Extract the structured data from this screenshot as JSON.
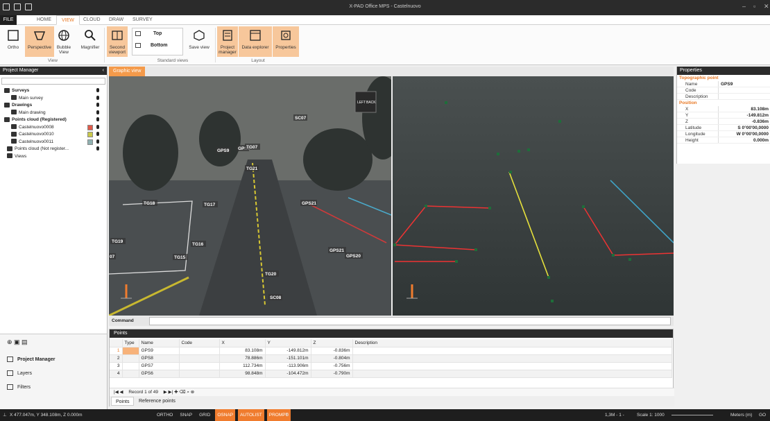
{
  "window": {
    "title": "X-PAD Office MPS - Castelnuovo"
  },
  "ribbon_tabs": [
    "FILE",
    "HOME",
    "VIEW",
    "CLOUD",
    "DRAW",
    "SURVEY"
  ],
  "ribbon": {
    "view_group": {
      "label": "View",
      "buttons": [
        "Ortho",
        "Perspective",
        "Bubble View",
        "Magnifier"
      ]
    },
    "second_viewport": "Second viewport",
    "standard_views": {
      "label": "Standard views",
      "items": [
        "Top",
        "Bottom"
      ],
      "save": "Save view"
    },
    "layout": {
      "label": "Layout",
      "buttons": [
        "Project manager",
        "Data explorer",
        "Properties"
      ]
    }
  },
  "project_manager": {
    "title": "Project Manager",
    "tree": [
      {
        "label": "Surveys",
        "bold": true
      },
      {
        "label": "Main survey"
      },
      {
        "label": "Drawings",
        "bold": true
      },
      {
        "label": "Main drawing"
      },
      {
        "label": "Points cloud (Registered)",
        "bold": true
      },
      {
        "label": "Castelnuovo0008",
        "color": "#e05a4a"
      },
      {
        "label": "Castelnuovo0010",
        "color": "#c9c84a"
      },
      {
        "label": "Castelnuovo0011",
        "color": "#8fb0b0"
      },
      {
        "label": "Points cloud (Not register..."
      },
      {
        "label": "Views"
      }
    ],
    "nav": [
      "Project Manager",
      "Layers",
      "Filters"
    ]
  },
  "graphic_view": {
    "tab": "Graphic view",
    "labels": [
      "GPS9",
      "GPS8",
      "TG07",
      "TG21",
      "SC07",
      "TG18",
      "TG17",
      "GPS21",
      "TG19",
      "TG16",
      "TG15",
      "GPS21",
      "GPS20",
      "TG20",
      "SC08",
      "07"
    ],
    "cube_labels": {
      "left": "LEFT",
      "back": "BACK"
    },
    "command_label": "Command"
  },
  "points_panel": {
    "title": "Points",
    "columns": [
      "Type",
      "Name",
      "Code",
      "X",
      "Y",
      "Z",
      "Description"
    ],
    "rows": [
      {
        "n": "1",
        "name": "GPS9",
        "code": "",
        "x": "83.108m",
        "y": "-149.812m",
        "z": "-0.836m"
      },
      {
        "n": "2",
        "name": "GPS8",
        "code": "",
        "x": "78.886m",
        "y": "-151.101m",
        "z": "-0.804m"
      },
      {
        "n": "3",
        "name": "GPS7",
        "code": "",
        "x": "112.734m",
        "y": "-113.906m",
        "z": "-0.756m"
      },
      {
        "n": "4",
        "name": "GPS6",
        "code": "",
        "x": "98.848m",
        "y": "-104.472m",
        "z": "-0.790m"
      }
    ],
    "record": "Record 1 of 49",
    "tabs": [
      "Points",
      "Reference points"
    ]
  },
  "properties": {
    "title": "Properties",
    "sections": [
      {
        "name": "Topographic point",
        "rows": [
          {
            "k": "Name",
            "v": "GPS9"
          },
          {
            "k": "Code",
            "v": ""
          },
          {
            "k": "Description",
            "v": ""
          }
        ]
      },
      {
        "name": "Position",
        "rows": [
          {
            "k": "X",
            "v": "83.108m"
          },
          {
            "k": "Y",
            "v": "-149.812m"
          },
          {
            "k": "Z",
            "v": "-0.836m"
          },
          {
            "k": "Latitude",
            "v": "S 0°00'00,0000"
          },
          {
            "k": "Longitude",
            "v": "W 0°00'00,0000"
          },
          {
            "k": "Height",
            "v": "0.000m"
          }
        ]
      }
    ]
  },
  "status": {
    "coords": "X 477.047m, Y 348.108m, Z 0.000m",
    "modes": [
      {
        "label": "ORTHO",
        "on": false
      },
      {
        "label": "SNAP",
        "on": false
      },
      {
        "label": "GRID",
        "on": false
      },
      {
        "label": "OSNAP",
        "on": true
      },
      {
        "label": "AUTOLIST",
        "on": true
      },
      {
        "label": "PROMPT",
        "on": true
      }
    ],
    "cloud": "1,3M - 1 -",
    "scale": "Scale 1: 1000",
    "units": "Meters (m)",
    "go": "GO"
  },
  "colors": {
    "accent": "#f07c2e",
    "dark": "#2b2b2b"
  }
}
